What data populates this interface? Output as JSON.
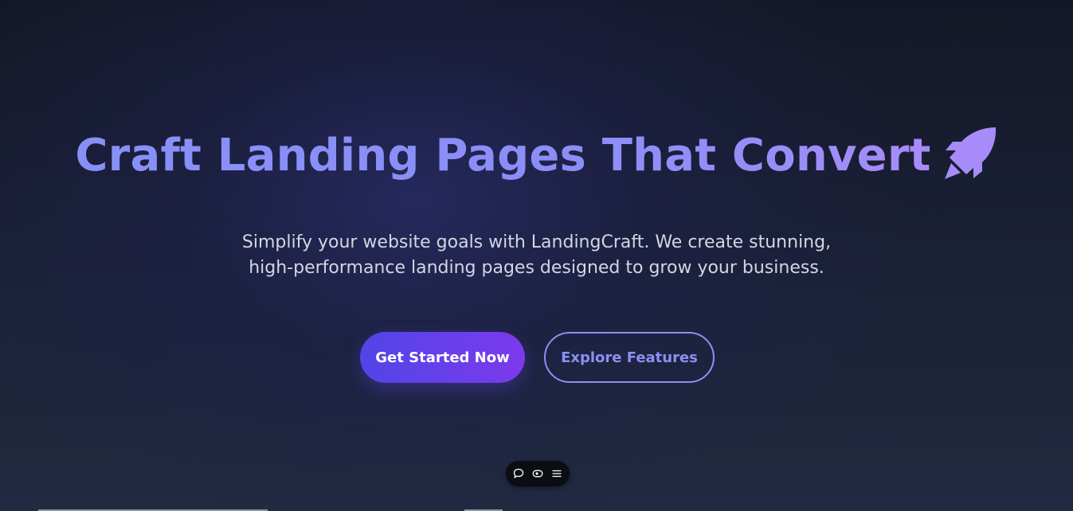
{
  "hero": {
    "headline": "Craft Landing Pages That Convert",
    "headline_icon": "rocket-icon",
    "subtitle_line1": "Simplify your website goals with LandingCraft. We create stunning,",
    "subtitle_line2": "high-performance landing pages designed to grow your business.",
    "primary_button": "Get Started Now",
    "secondary_button": "Explore Features"
  },
  "toolbar": {
    "icons": [
      "comment-icon",
      "eye-icon",
      "menu-icon"
    ]
  },
  "colors": {
    "headline_gradient_start": "#8890f7",
    "headline_gradient_end": "#a78bfa",
    "primary_button_start": "#5145e8",
    "primary_button_end": "#7c3aed",
    "secondary_button_border": "#8b90f3",
    "background_top": "#131827",
    "background_bottom": "#212a40"
  }
}
